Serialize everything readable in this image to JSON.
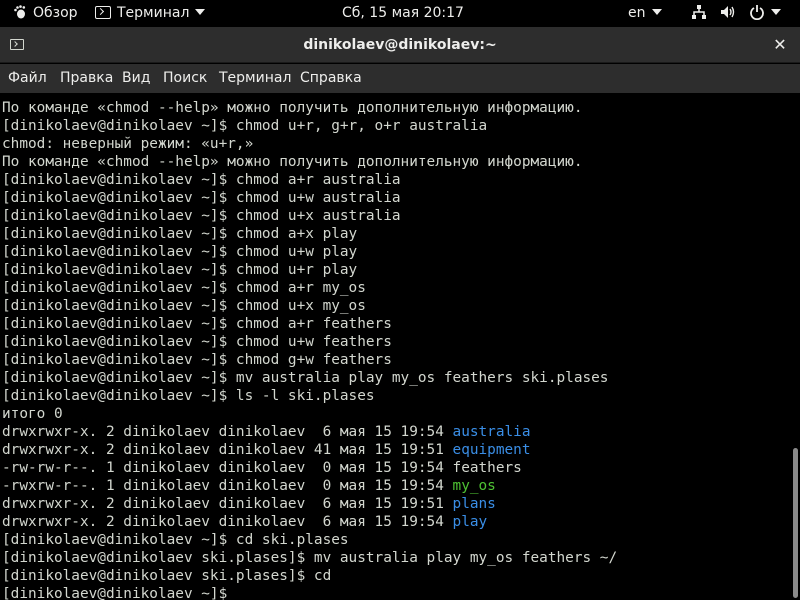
{
  "topbar": {
    "activities": "Обзор",
    "app_menu": "Терминал",
    "clock": "Сб, 15 мая  20:17",
    "language": "en"
  },
  "window": {
    "title": "dinikolaev@dinikolaev:~",
    "close_glyph": "✕"
  },
  "menu": [
    "Файл",
    "Правка",
    "Вид",
    "Поиск",
    "Терминал",
    "Справка"
  ],
  "terminal": {
    "lines": [
      {
        "text": "По команде «chmod --help» можно получить дополнительную информацию."
      },
      {
        "text": "[dinikolaev@dinikolaev ~]$ chmod u+r, g+r, o+r australia"
      },
      {
        "text": "chmod: неверный режим: «u+r,»"
      },
      {
        "text": "По команде «chmod --help» можно получить дополнительную информацию."
      },
      {
        "text": "[dinikolaev@dinikolaev ~]$ chmod a+r australia"
      },
      {
        "text": "[dinikolaev@dinikolaev ~]$ chmod u+w australia"
      },
      {
        "text": "[dinikolaev@dinikolaev ~]$ chmod u+x australia"
      },
      {
        "text": "[dinikolaev@dinikolaev ~]$ chmod a+x play"
      },
      {
        "text": "[dinikolaev@dinikolaev ~]$ chmod u+w play"
      },
      {
        "text": "[dinikolaev@dinikolaev ~]$ chmod u+r play"
      },
      {
        "text": "[dinikolaev@dinikolaev ~]$ chmod a+r my_os"
      },
      {
        "text": "[dinikolaev@dinikolaev ~]$ chmod u+x my_os"
      },
      {
        "text": "[dinikolaev@dinikolaev ~]$ chmod a+r feathers"
      },
      {
        "text": "[dinikolaev@dinikolaev ~]$ chmod u+w feathers"
      },
      {
        "text": "[dinikolaev@dinikolaev ~]$ chmod g+w feathers"
      },
      {
        "text": "[dinikolaev@dinikolaev ~]$ mv australia play my_os feathers ski.plases"
      },
      {
        "text": "[dinikolaev@dinikolaev ~]$ ls -l ski.plases"
      },
      {
        "text": "итого 0"
      },
      {
        "text": "drwxrwxr-x. 2 dinikolaev dinikolaev  6 мая 15 19:54 ",
        "name": "australia",
        "color": "#3a8ee6"
      },
      {
        "text": "drwxrwxr-x. 2 dinikolaev dinikolaev 41 мая 15 19:51 ",
        "name": "equipment",
        "color": "#3a8ee6"
      },
      {
        "text": "-rw-rw-r--. 1 dinikolaev dinikolaev  0 мая 15 19:54 ",
        "name": "feathers",
        "color": "#d3d7cf"
      },
      {
        "text": "-rwxrw-r--. 1 dinikolaev dinikolaev  0 мая 15 19:54 ",
        "name": "my_os",
        "color": "#4ec233"
      },
      {
        "text": "drwxrwxr-x. 2 dinikolaev dinikolaev  6 мая 15 19:51 ",
        "name": "plans",
        "color": "#3a8ee6"
      },
      {
        "text": "drwxrwxr-x. 2 dinikolaev dinikolaev  6 мая 15 19:54 ",
        "name": "play",
        "color": "#3a8ee6"
      },
      {
        "text": "[dinikolaev@dinikolaev ~]$ cd ski.plases"
      },
      {
        "text": "[dinikolaev@dinikolaev ski.plases]$ mv australia play my_os feathers ~/"
      },
      {
        "text": "[dinikolaev@dinikolaev ski.plases]$ cd"
      },
      {
        "text": "[dinikolaev@dinikolaev ~]$ "
      }
    ]
  },
  "icons": {
    "activities": "gnome-foot-icon",
    "app": "terminal-icon",
    "network": "network-icon",
    "volume": "volume-icon",
    "power": "power-icon"
  },
  "colors": {
    "directory": "#3a8ee6",
    "executable": "#4ec233",
    "text": "#d3d7cf",
    "background": "#000000",
    "titlebar": "#2d2d2d"
  }
}
